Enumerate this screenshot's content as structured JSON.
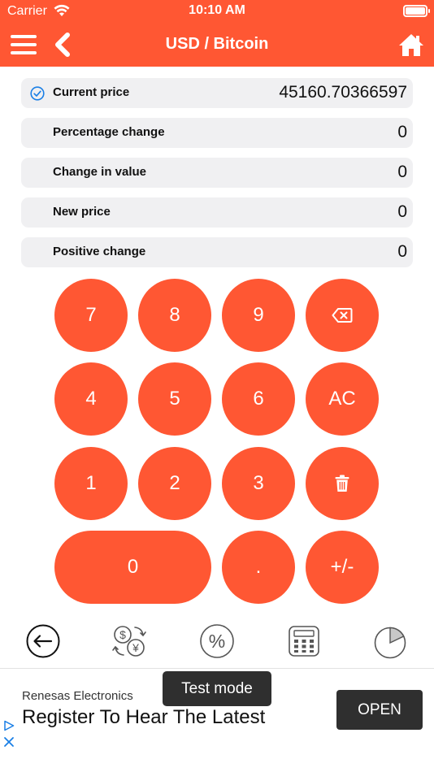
{
  "status_bar": {
    "carrier": "Carrier",
    "time": "10:10 AM",
    "icons": [
      "wifi-icon",
      "battery-icon"
    ]
  },
  "nav": {
    "title": "USD / Bitcoin",
    "icons": [
      "menu-icon",
      "back-chevron-icon",
      "home-icon"
    ]
  },
  "fields": [
    {
      "label": "Current price",
      "value": "45160.70366597",
      "selected": true
    },
    {
      "label": "Percentage change",
      "value": "0",
      "selected": false
    },
    {
      "label": "Change in value",
      "value": "0",
      "selected": false
    },
    {
      "label": "New price",
      "value": "0",
      "selected": false
    },
    {
      "label": "Positive change",
      "value": "0",
      "selected": false
    }
  ],
  "keypad": {
    "k7": "7",
    "k8": "8",
    "k9": "9",
    "backspace_icon": "backspace-icon",
    "k4": "4",
    "k5": "5",
    "k6": "6",
    "clear": "AC",
    "k1": "1",
    "k2": "2",
    "k3": "3",
    "delete_icon": "trash-icon",
    "k0": "0",
    "dot": ".",
    "sign": "+/-"
  },
  "toolbar": {
    "icons": [
      "back-arrow-icon",
      "currency-exchange-icon",
      "percent-icon",
      "calculator-icon",
      "pie-chart-icon"
    ]
  },
  "ad": {
    "sponsor": "Renesas Electronics",
    "headline": "Register To Hear The Latest",
    "cta": "OPEN",
    "badge": "Test mode",
    "icons": [
      "ad-choices-icon",
      "close-icon"
    ]
  },
  "colors": {
    "accent": "#ff5733",
    "field_bg": "#f0f0f2",
    "check": "#1a7fe6"
  }
}
